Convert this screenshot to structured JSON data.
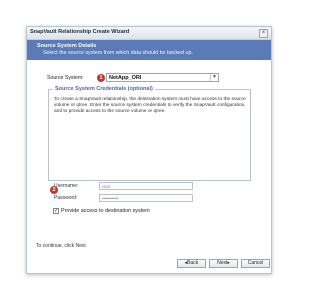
{
  "window": {
    "title": "SnapVault Relationship Create Wizard",
    "close_glyph": "×"
  },
  "header": {
    "title": "Source System Details",
    "description": "Select the source system from which data should be backed up."
  },
  "source": {
    "label": "Source System:",
    "selected_value": "NetApp_ORI",
    "dropdown_glyph": "▼"
  },
  "badges": {
    "one": "1",
    "two": "2"
  },
  "credentials": {
    "title": "Source System Credentials (optional)",
    "description": "To create a SnapVault relationship, the destination system must have access to the source volume or qtree. Enter the source system credentials to verify the SnapVault configuration, and to provide access to the source volume or qtree.",
    "username_label": "Username:",
    "username_value": "root",
    "password_label": "Password:",
    "password_value": "••••••••••",
    "checkbox_label": "Provide access to destination system",
    "checkbox_checked": true,
    "checkbox_glyph": "✓"
  },
  "footer": {
    "hint": "To continue, click Next",
    "back_label": "◂Back",
    "next_label": "Next▸",
    "cancel_label": "Cancel"
  },
  "colors": {
    "header_bg": "#5a7bb6",
    "badge": "#c0392b",
    "group_title": "#4a6aa5"
  }
}
